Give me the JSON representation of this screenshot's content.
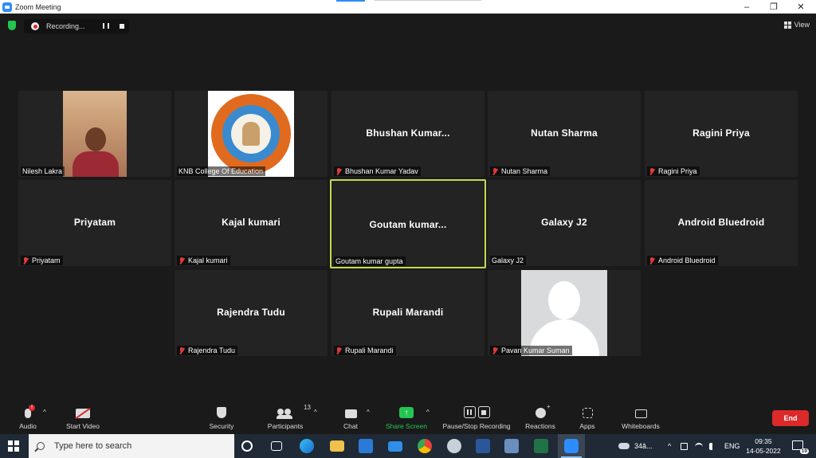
{
  "window": {
    "title": "Zoom Meeting",
    "controls": [
      "–",
      "❐",
      "✕"
    ]
  },
  "top": {
    "recording_label": "Recording...",
    "view_label": "View"
  },
  "tiles": [
    {
      "name": "",
      "label": "Nilesh Lakra",
      "muted": false,
      "kind": "photo",
      "active": false
    },
    {
      "name": "",
      "label": "KNB College Of Education",
      "muted": false,
      "kind": "logo",
      "active": false
    },
    {
      "name": "Bhushan  Kumar...",
      "label": "Bhushan Kumar Yadav",
      "muted": true,
      "kind": "name",
      "active": false
    },
    {
      "name": "Nutan Sharma",
      "label": "Nutan Sharma",
      "muted": true,
      "kind": "name",
      "active": false
    },
    {
      "name": "Ragini Priya",
      "label": "Ragini Priya",
      "muted": true,
      "kind": "name",
      "active": false
    },
    {
      "name": "Priyatam",
      "label": "Priyatam",
      "muted": true,
      "kind": "name",
      "active": false
    },
    {
      "name": "Kajal kumari",
      "label": "Kajal kumari",
      "muted": true,
      "kind": "name",
      "active": false
    },
    {
      "name": "Goutam  kumar...",
      "label": "Goutam kumar gupta",
      "muted": false,
      "kind": "name",
      "active": true
    },
    {
      "name": "Galaxy J2",
      "label": "Galaxy J2",
      "muted": false,
      "kind": "name",
      "active": false
    },
    {
      "name": "Android Bluedroid",
      "label": "Android Bluedroid",
      "muted": true,
      "kind": "name",
      "active": false
    },
    {
      "name": "Rajendra Tudu",
      "label": "Rajendra Tudu",
      "muted": true,
      "kind": "name",
      "active": false
    },
    {
      "name": "Rupali Marandi",
      "label": "Rupali Marandi",
      "muted": true,
      "kind": "name",
      "active": false
    },
    {
      "name": "",
      "label": "Pavan Kumar Suman",
      "muted": true,
      "kind": "avatar",
      "active": false
    }
  ],
  "toolbar": {
    "audio": "Audio",
    "audio_alert": "!",
    "start_video": "Start Video",
    "security": "Security",
    "participants": "Participants",
    "participants_count": "13",
    "chat": "Chat",
    "share_screen": "Share Screen",
    "pause_stop_recording": "Pause/Stop Recording",
    "reactions": "Reactions",
    "apps": "Apps",
    "whiteboards": "Whiteboards",
    "end": "End",
    "caret": "^"
  },
  "taskbar": {
    "search_placeholder": "Type here to search",
    "weather": "34â...",
    "language": "ENG",
    "time": "09:35",
    "date": "14-05-2022",
    "notifications": "19"
  },
  "colors": {
    "active_speaker_border": "#c7d94e",
    "share_green": "#23c552",
    "end_red": "#dc2a2a",
    "taskbar": "#1f2a36"
  }
}
